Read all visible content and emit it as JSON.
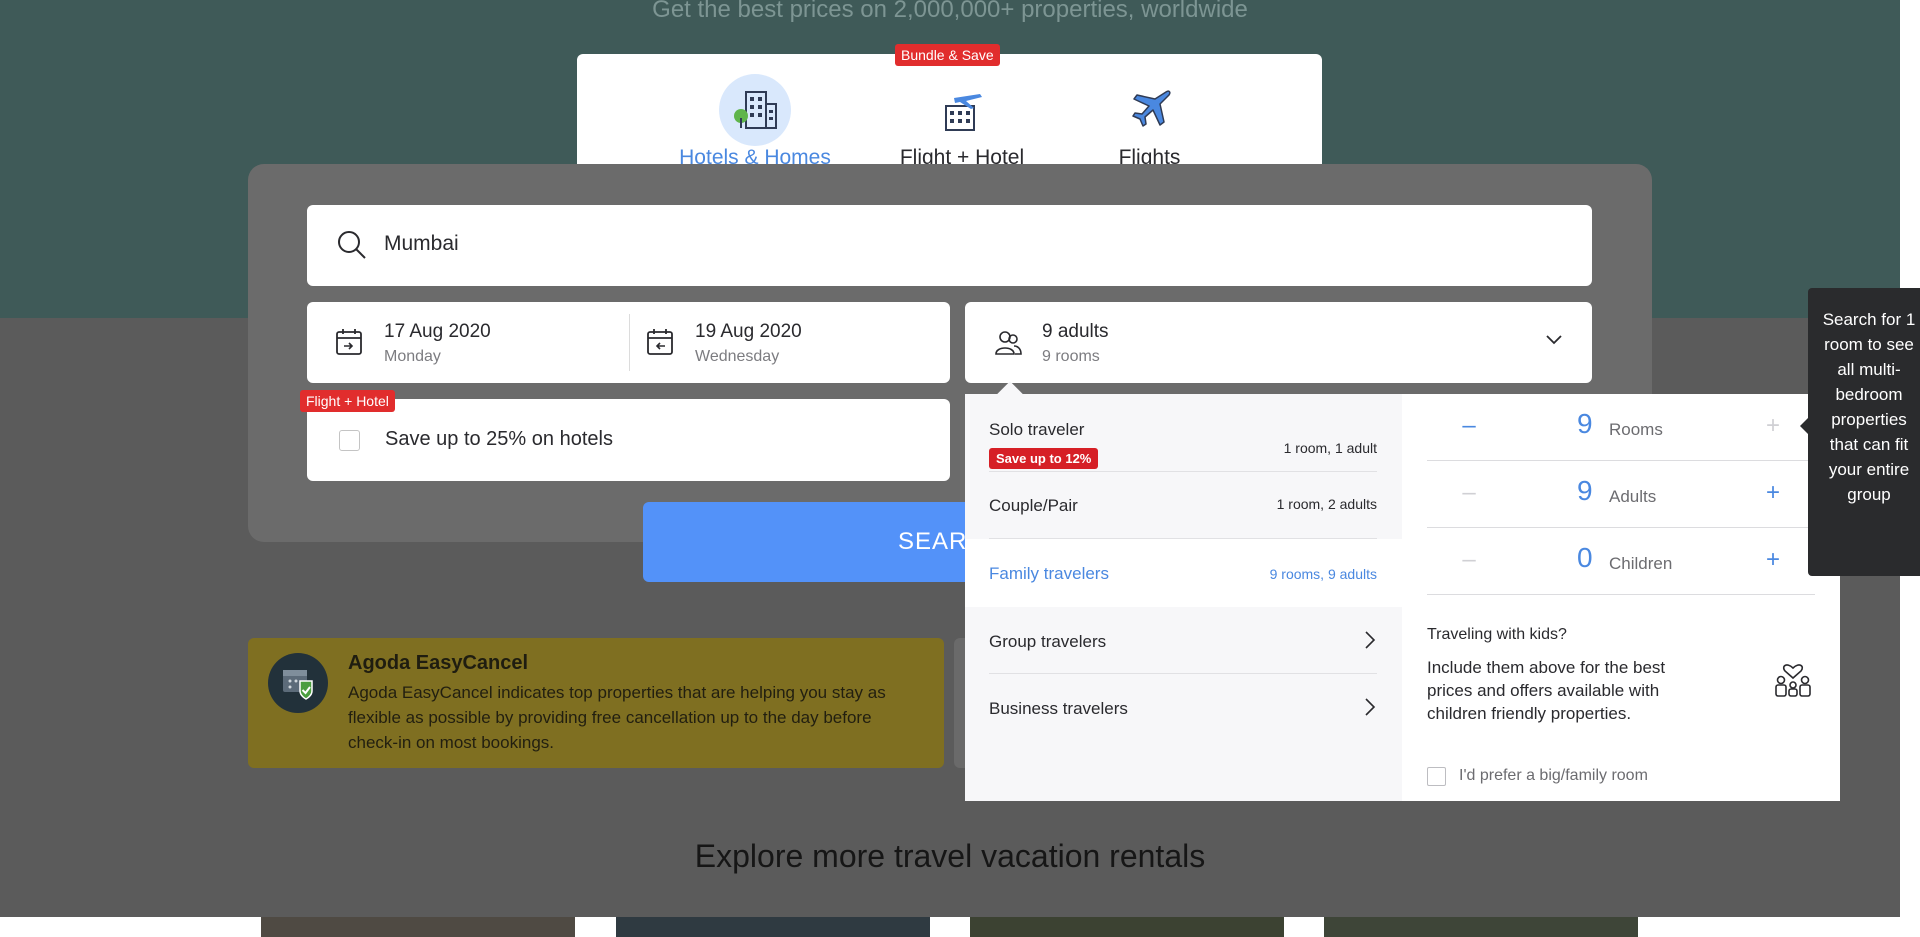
{
  "hero": {
    "tagline": "Get the best prices on 2,000,000+ properties, worldwide"
  },
  "tabs": [
    {
      "label": "Hotels & Homes",
      "active": true
    },
    {
      "label": "Flight + Hotel",
      "badge": "Bundle & Save"
    },
    {
      "label": "Flights"
    }
  ],
  "search": {
    "destination": "Mumbai",
    "checkin": {
      "date": "17 Aug 2020",
      "day": "Monday"
    },
    "checkout": {
      "date": "19 Aug 2020",
      "day": "Wednesday"
    },
    "occupancy": {
      "main": "9 adults",
      "sub": "9 rooms"
    },
    "package": {
      "badge": "Flight + Hotel",
      "label": "Save up to 25% on hotels"
    },
    "button": "SEARCH"
  },
  "traveler_types": [
    {
      "label": "Solo traveler",
      "detail": "1 room, 1 adult",
      "badge": "Save up to 12%"
    },
    {
      "label": "Couple/Pair",
      "detail": "1 room, 2 adults"
    },
    {
      "label": "Family travelers",
      "detail": "9 rooms, 9 adults",
      "active": true
    },
    {
      "label": "Group travelers"
    },
    {
      "label": "Business travelers"
    }
  ],
  "counters": {
    "rooms": {
      "value": "9",
      "label": "Rooms"
    },
    "adults": {
      "value": "9",
      "label": "Adults"
    },
    "children": {
      "value": "0",
      "label": "Children"
    },
    "minus": "–",
    "plus": "+"
  },
  "kids": {
    "title": "Traveling with kids?",
    "text": "Include them above for the best prices and offers available with children friendly properties.",
    "checkbox_label": "I'd prefer a big/family room"
  },
  "tooltip": {
    "text": "Search for 1 room to see all multi-bedroom properties that can fit your entire group"
  },
  "easycancel": {
    "title": "Agoda EasyCancel",
    "text": "Agoda EasyCancel indicates top properties that are helping you stay as flexible as possible by providing free cancellation up to the day before check-in on most bookings."
  },
  "explore": {
    "title": "Explore more travel vacation rentals"
  },
  "colors": {
    "accent": "#5392f9",
    "badge": "#e12d2d",
    "hero": "#3f5a58"
  }
}
